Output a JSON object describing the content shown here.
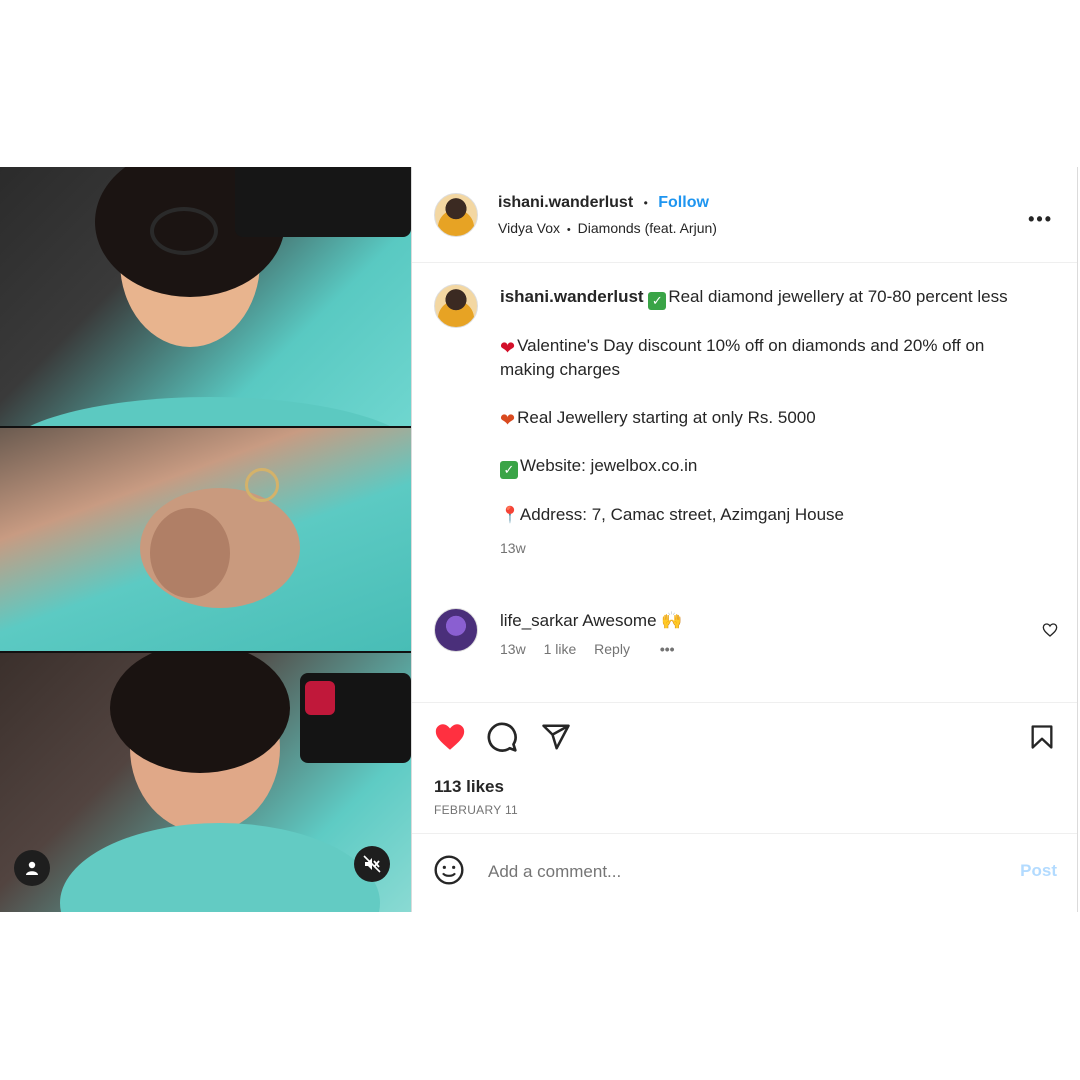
{
  "post": {
    "username": "ishani.wanderlust",
    "separator": "•",
    "follow_label": "Follow",
    "audio_artist": "Vidya Vox",
    "audio_dot": "•",
    "audio_track": "Diamonds (feat. Arjun)",
    "more_label": "•••"
  },
  "caption": {
    "username": "ishani.wanderlust",
    "line1": "Real diamond jewellery at 70-80 percent less",
    "line2": "Valentine's Day discount 10% off on diamonds and 20% off on making charges",
    "line3": "Real Jewellery starting at only Rs. 5000",
    "line4": "Website: jewelbox.co.in",
    "line5": "Address: 7, Camac street, Azimganj House",
    "time": "13w"
  },
  "comment": {
    "username": "life_sarkar",
    "text": "Awesome 🙌",
    "time": "13w",
    "likes": "1 like",
    "reply": "Reply",
    "more": "•••"
  },
  "actions": {
    "likes_count": "113 likes",
    "date": "FEBRUARY 11"
  },
  "add_comment": {
    "placeholder": "Add a comment...",
    "post_label": "Post"
  },
  "colors": {
    "accent": "#1e95f0",
    "heart": "#ff3040",
    "post_disabled": "#b3dbff"
  },
  "icons": [
    "tag-user-icon",
    "audio-muted-icon",
    "more-icon",
    "heart-icon",
    "comment-icon",
    "share-icon",
    "bookmark-icon",
    "emoji-icon",
    "like-comment-icon"
  ]
}
